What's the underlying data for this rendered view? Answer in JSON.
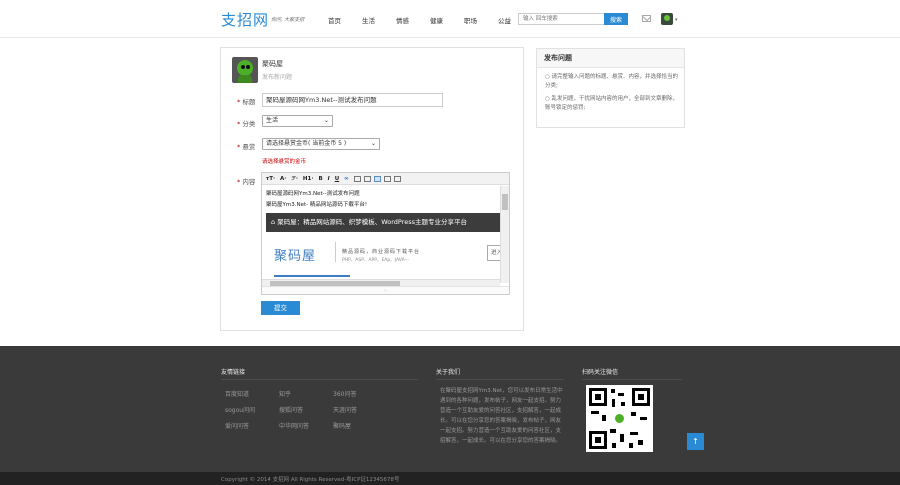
{
  "header": {
    "logo": "支招网",
    "slogan": "你问, 大家支招",
    "nav": [
      "首页",
      "生活",
      "情感",
      "健康",
      "职场",
      "公益"
    ],
    "search_placeholder": "输入 回车搜索",
    "search_button": "搜索",
    "brand_color": "#2a8ad4"
  },
  "form": {
    "user_name": "聚码屋",
    "user_sub": "发布新问题",
    "label_title": "标题",
    "label_category": "分类",
    "label_reward": "悬赏",
    "label_content": "内容",
    "required_mark": "*",
    "title_value": "聚码屋源码网Ym3.Net--测试发布问题",
    "category_value": "生活",
    "reward_value": "请选择悬赏金币( 当前金币 5 )",
    "reward_error": "请选择悬赏的金币",
    "submit": "提交"
  },
  "editor": {
    "toolbar": [
      "ᴛT·",
      "A·",
      "ℱ·",
      "H1·",
      "B",
      "I",
      "U",
      "∞"
    ],
    "line1": "聚码屋源码网Ym3.Net--测试发布问题",
    "line2": "聚码屋Ym3.Net- 精品网站源码下载平台!",
    "banner": "聚码屋：精品网站源码、织梦模板、WordPress主题专业分享平台",
    "logo_text": "聚码屋",
    "tagline": "精品源码，商业源码下载平台",
    "tech": "PHP、ASP、APP、EAp、JAVA···",
    "button_text": "进入"
  },
  "sidebar": {
    "title": "发布问题",
    "items": [
      "○ 请完整输入问题的标题、悬赏、内容，并选择恰当的分类;",
      "○ 乱发问题，干扰网站内容的用户，全部到文章删除，账号锁定的惩罚;"
    ]
  },
  "footer": {
    "links_title": "友情链接",
    "links": [
      [
        "百度知道",
        "知乎",
        "360问答"
      ],
      [
        "sogou问问",
        "搜狐问答",
        "天涯问答"
      ],
      [
        "爱问问答",
        "中华网问答",
        "聚码屋"
      ]
    ],
    "about_title": "关于我们",
    "about_text": "在聚码屋支招网Ym3.Net，您可以发布日常生活中遇到的各种问题，发布帖子，网友一起支招。努力营造一个互助友爱的问答社区，支招解答，一起成长。可以在您分享您的答案揭晓，发布帖子，网友一起支招。努力营造一个互助友爱的问答社区，支招解答，一起成长。可以在您分享您的答案揭晓。",
    "wechat_title": "扫码关注微信",
    "to_top": "↑",
    "copyright": "Copyright © 2014 支招网 All Rights Reserved-粤ICP证12345678号"
  }
}
